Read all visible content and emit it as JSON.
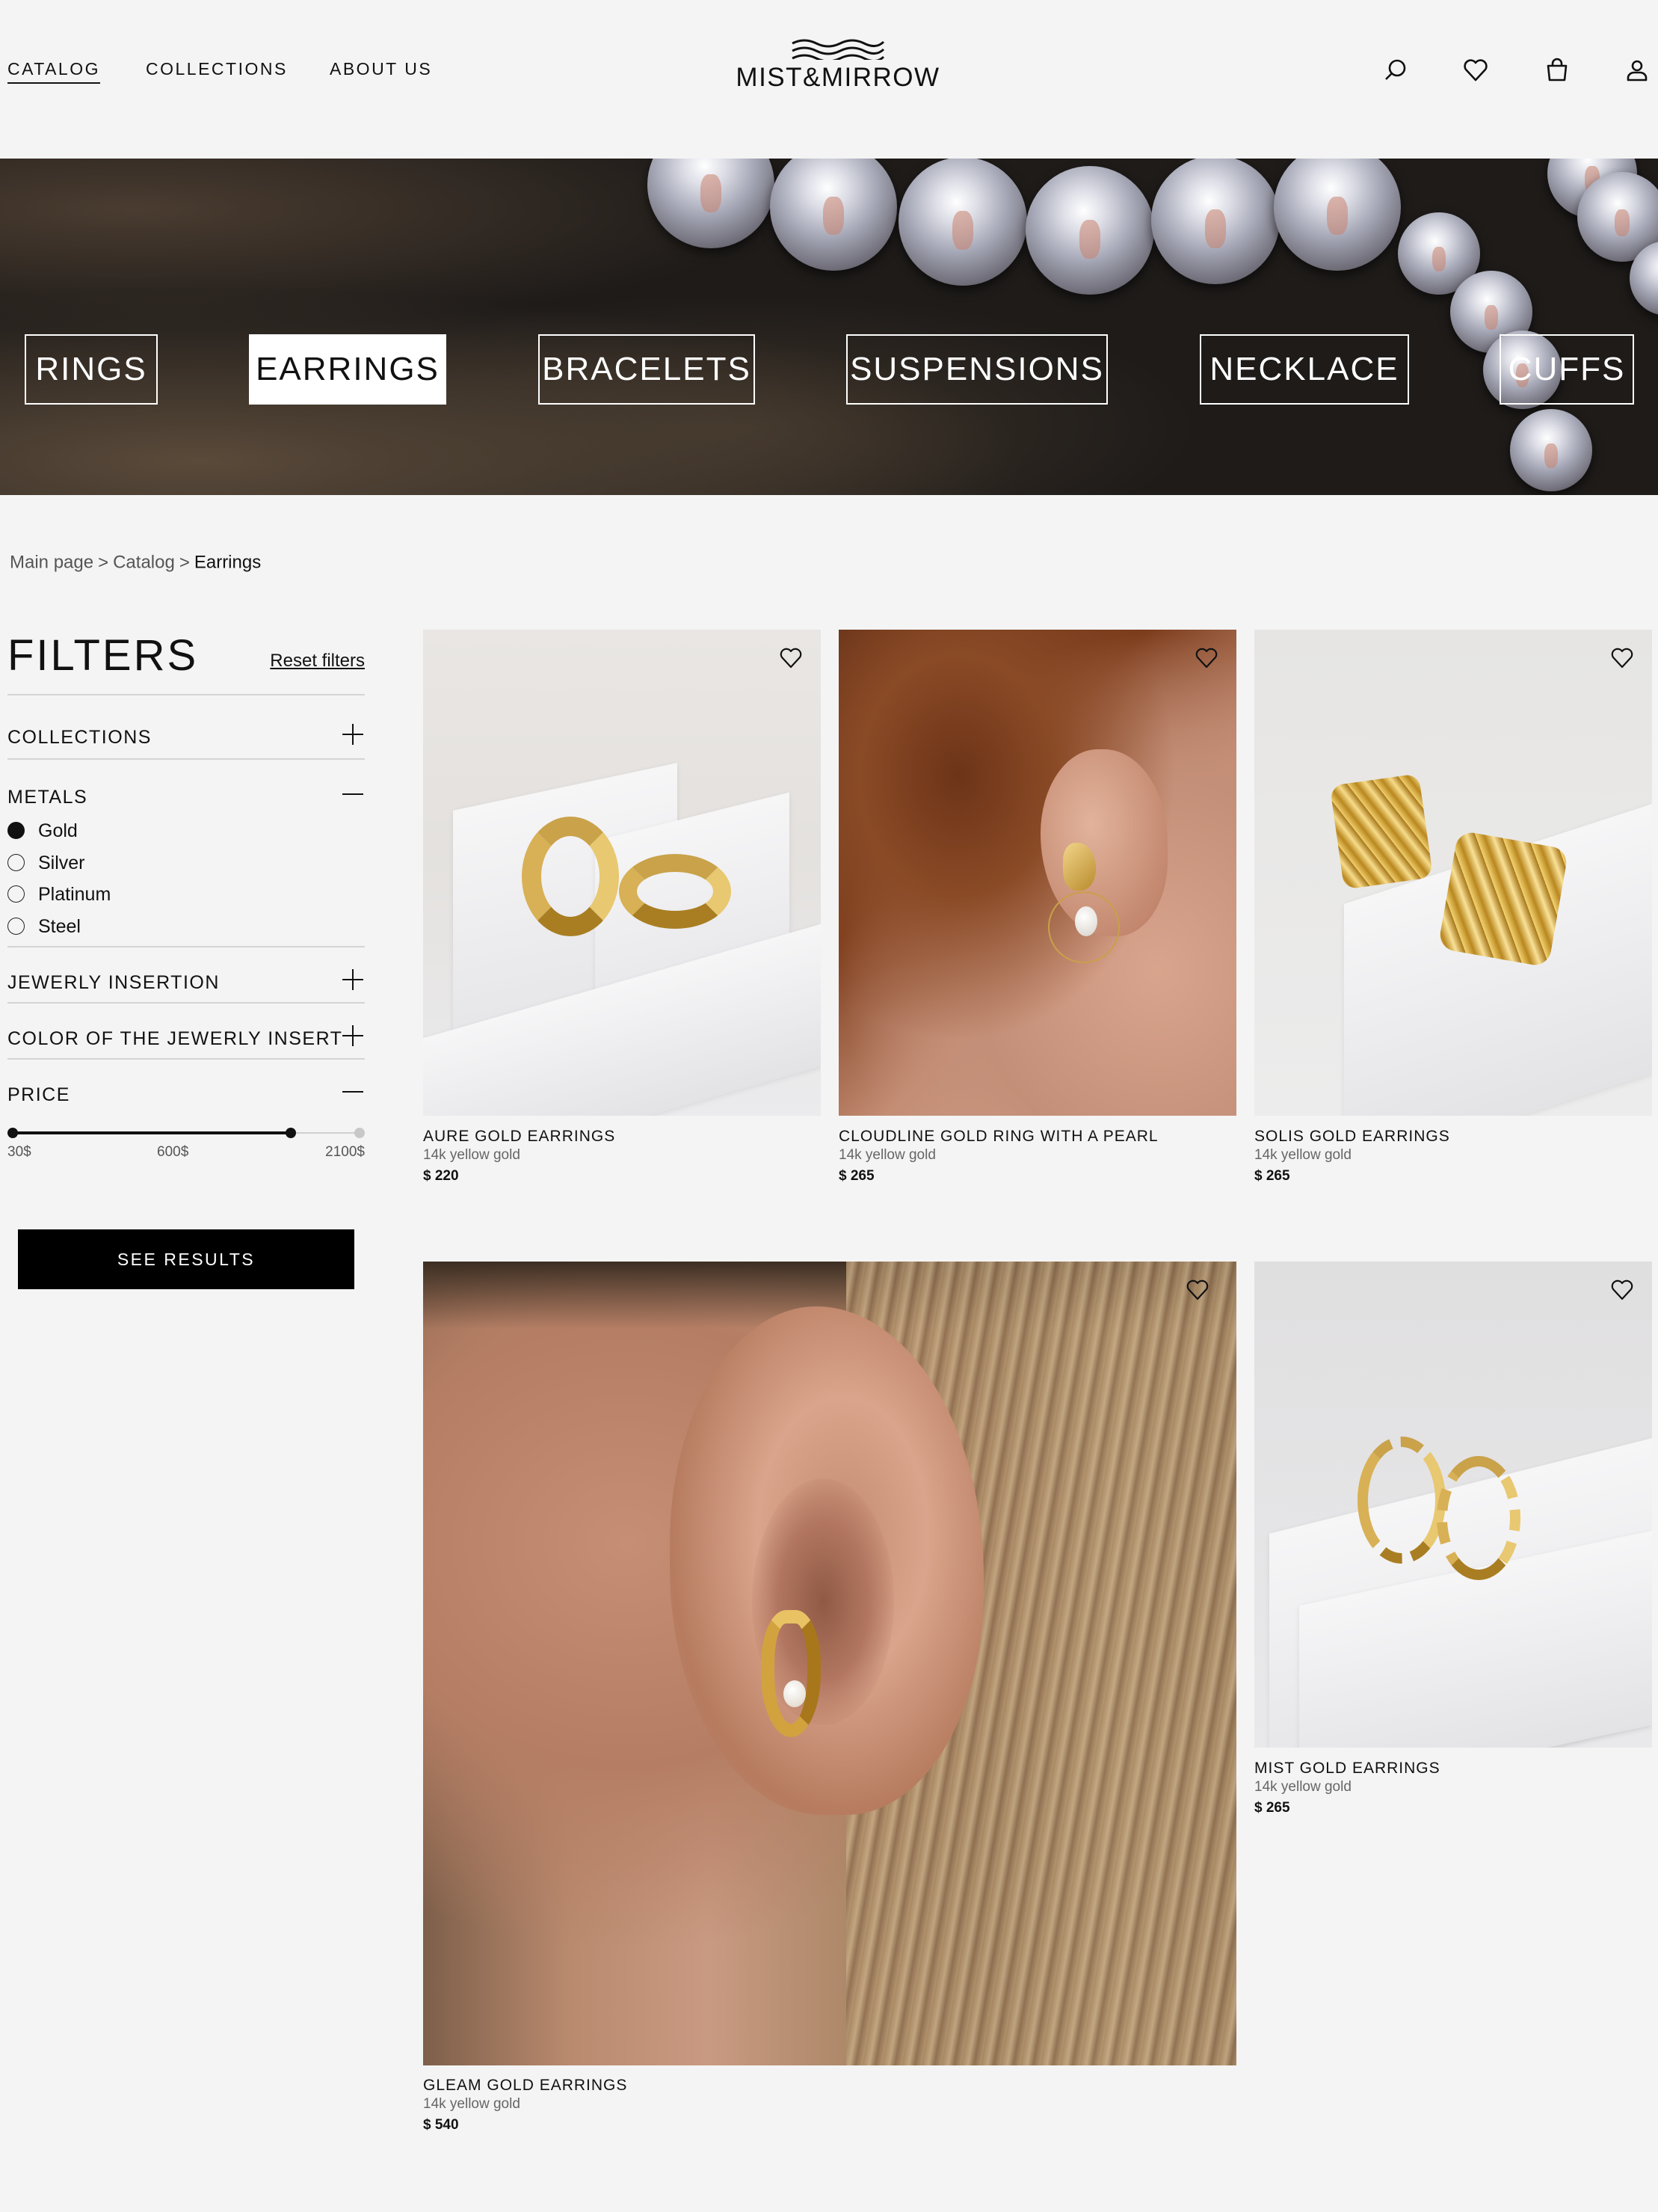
{
  "header": {
    "nav": [
      "CATALOG",
      "COLLECTIONS",
      "ABOUT US"
    ],
    "brand": "MIST&MIRROW",
    "icons": [
      "search-icon",
      "heart-icon",
      "bag-icon",
      "user-icon"
    ]
  },
  "banner": {
    "categories": [
      "RINGS",
      "EARRINGS",
      "BRACELETS",
      "SUSPENSIONS",
      "NECKLACE",
      "CUFFS"
    ],
    "active": "EARRINGS"
  },
  "breadcrumb": {
    "items": [
      "Main page",
      "Catalog",
      "Earrings"
    ],
    "separator": ">"
  },
  "filters": {
    "title": "FILTERS",
    "reset_label": "Reset filters",
    "sections": {
      "collections": "COLLECTIONS",
      "metals": "METALS",
      "insertion": "JEWERLY INSERTION",
      "insert_color": "COLOR OF THE JEWERLY INSERT",
      "price": "PRICE"
    },
    "metals": [
      {
        "label": "Gold",
        "selected": true
      },
      {
        "label": "Silver",
        "selected": false
      },
      {
        "label": "Platinum",
        "selected": false
      },
      {
        "label": "Steel",
        "selected": false
      }
    ],
    "price": {
      "min_label": "30$",
      "value_label": "600$",
      "max_label": "2100$",
      "min": 30,
      "value": 600,
      "max": 2100
    },
    "see_results_label": "SEE RESULTS"
  },
  "products": [
    {
      "name": "AURE GOLD EARRINGS",
      "material": "14k yellow gold",
      "price": "$ 220"
    },
    {
      "name": "CLOUDLINE GOLD RING WITH A PEARL",
      "material": "14k yellow gold",
      "price": "$ 265"
    },
    {
      "name": "SOLIS GOLD EARRINGS",
      "material": "14k yellow gold",
      "price": "$ 265"
    },
    {
      "name": "GLEAM GOLD EARRINGS",
      "material": "14k yellow gold",
      "price": "$ 540"
    },
    {
      "name": "MIST GOLD EARRINGS",
      "material": "14k yellow gold",
      "price": "$ 265"
    }
  ],
  "colors": {
    "background": "#f4f4f4",
    "text": "#111111",
    "button": "#000000",
    "gold": "#d4ab4e"
  }
}
